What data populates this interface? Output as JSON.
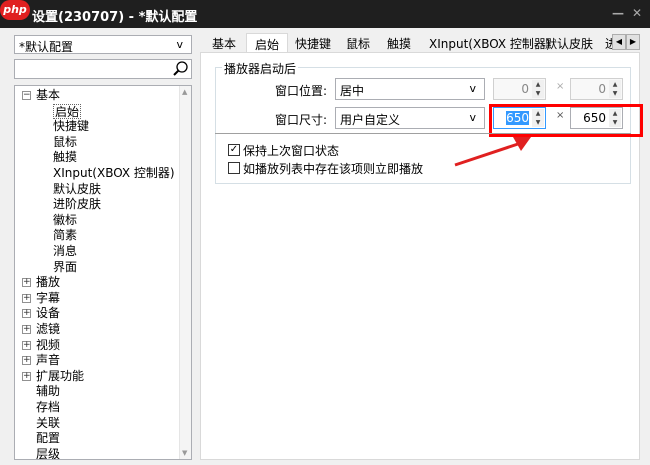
{
  "window": {
    "title": "设置(230707) - *默认配置",
    "logo": "php",
    "min": "—",
    "close": "✕"
  },
  "left": {
    "profile": "*默认配置",
    "search_placeholder": "",
    "tree": [
      {
        "label": "基本",
        "level": 0,
        "exp": "−"
      },
      {
        "label": "启始",
        "level": 1
      },
      {
        "label": "快捷键",
        "level": 1
      },
      {
        "label": "鼠标",
        "level": 1
      },
      {
        "label": "触摸",
        "level": 1
      },
      {
        "label": "XInput(XBOX 控制器)",
        "level": 1
      },
      {
        "label": "默认皮肤",
        "level": 1
      },
      {
        "label": "进阶皮肤",
        "level": 1
      },
      {
        "label": "徽标",
        "level": 1
      },
      {
        "label": "简素",
        "level": 1
      },
      {
        "label": "消息",
        "level": 1
      },
      {
        "label": "界面",
        "level": 1
      },
      {
        "label": "播放",
        "level": 0,
        "exp": "+"
      },
      {
        "label": "字幕",
        "level": 0,
        "exp": "+"
      },
      {
        "label": "设备",
        "level": 0,
        "exp": "+"
      },
      {
        "label": "滤镜",
        "level": 0,
        "exp": "+"
      },
      {
        "label": "视频",
        "level": 0,
        "exp": "+"
      },
      {
        "label": "声音",
        "level": 0,
        "exp": "+"
      },
      {
        "label": "扩展功能",
        "level": 0,
        "exp": "+"
      },
      {
        "label": "辅助",
        "level": 0
      },
      {
        "label": "存档",
        "level": 0
      },
      {
        "label": "关联",
        "level": 0
      },
      {
        "label": "配置",
        "level": 0
      },
      {
        "label": "层级",
        "level": 0
      }
    ]
  },
  "tabs": [
    "基本",
    "启始",
    "快捷键",
    "鼠标",
    "触摸",
    "XInput(XBOX 控制器)",
    "默认皮肤",
    "进"
  ],
  "group": {
    "title": "播放器启动后",
    "position": {
      "label": "窗口位置:",
      "value": "居中",
      "x": "0",
      "y": "0"
    },
    "size": {
      "label": "窗口尺寸:",
      "value": "用户自定义",
      "w": "650",
      "h": "650"
    },
    "times": "×",
    "dropdown": "v"
  },
  "options": [
    {
      "label": "保持上次窗口状态",
      "checked": true
    },
    {
      "label": "如播放列表中存在该项则立即播放",
      "checked": false
    }
  ],
  "colors": {
    "highlight": "#ff0000",
    "arrow": "#e02020"
  }
}
